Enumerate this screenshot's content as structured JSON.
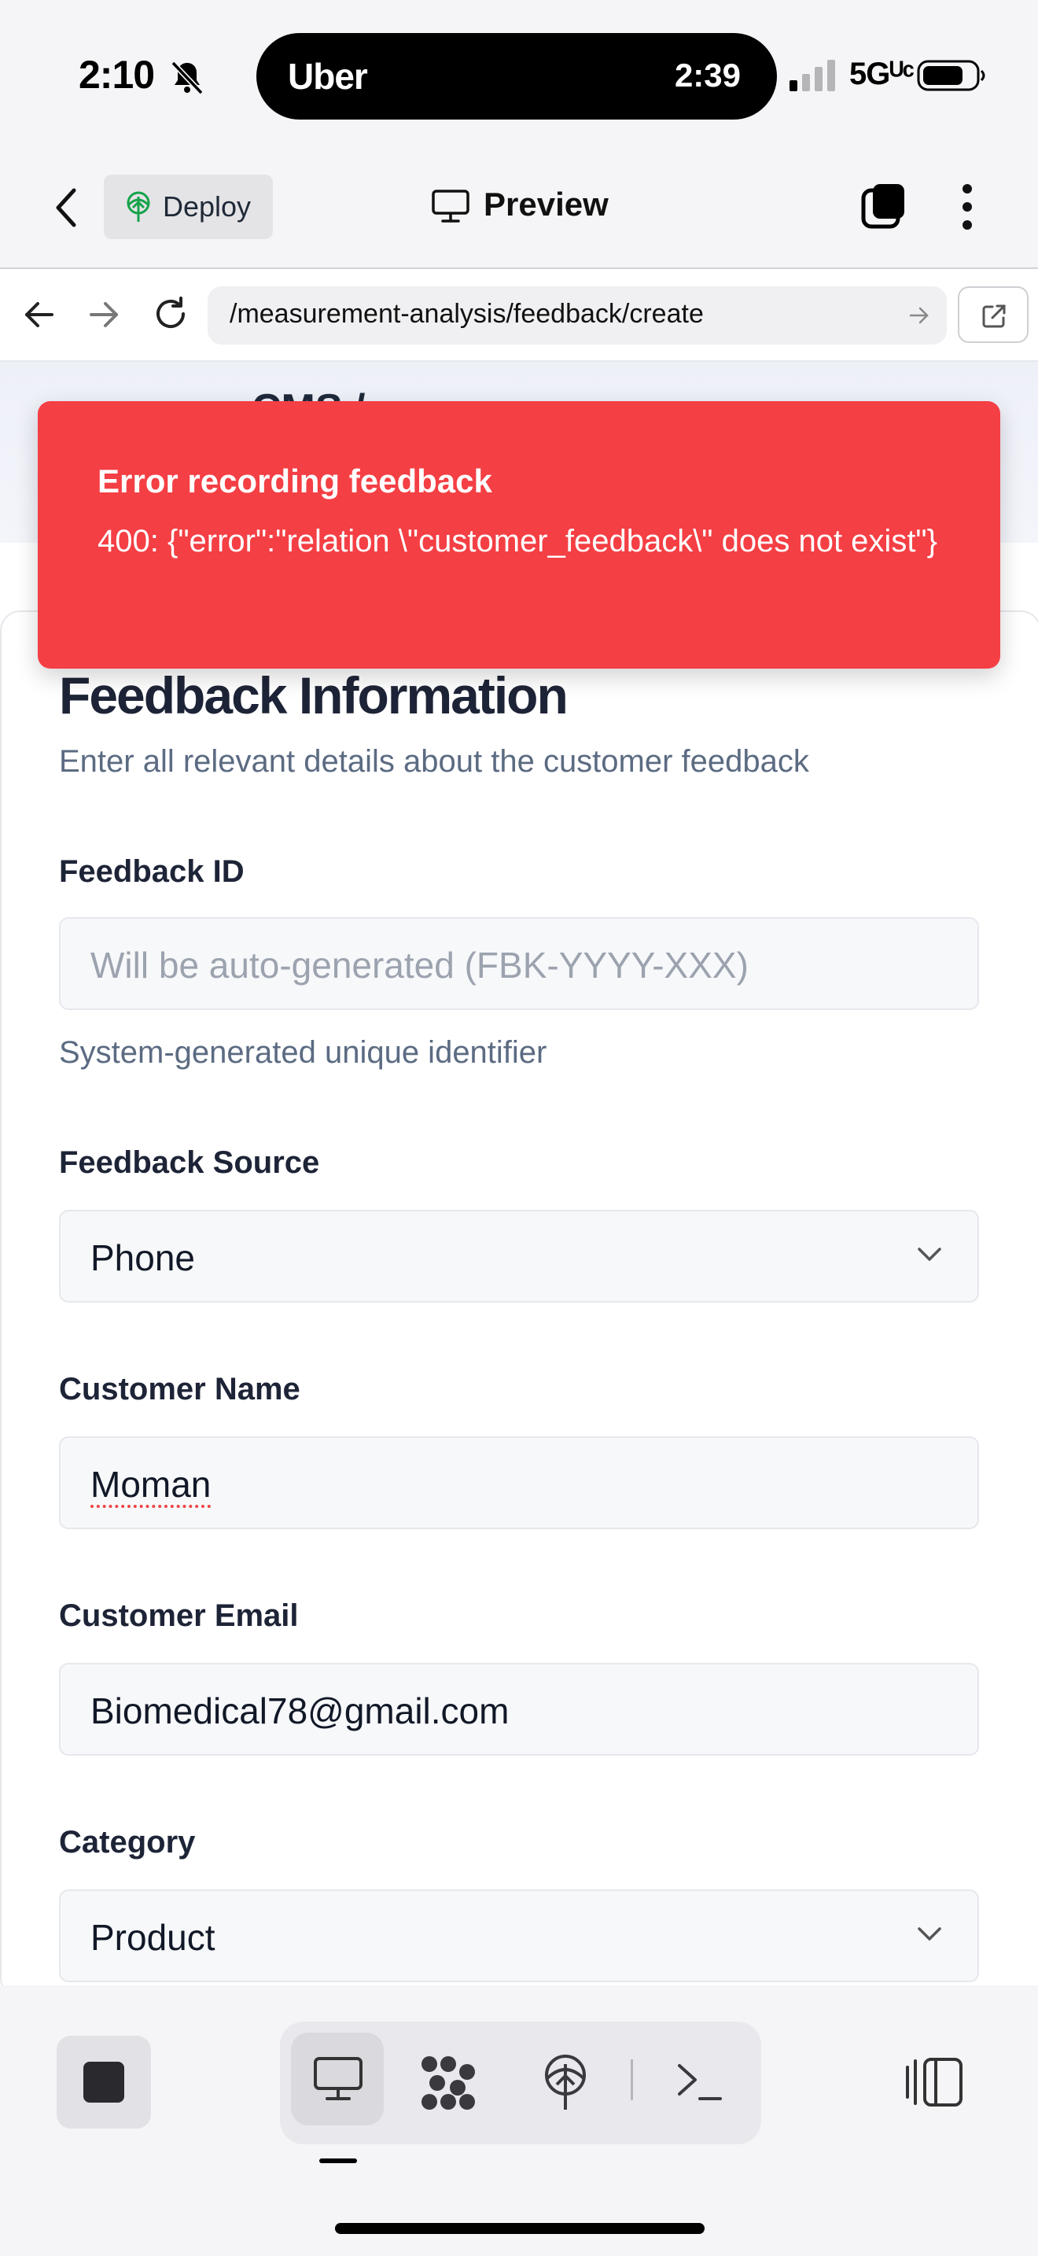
{
  "status_bar": {
    "time": "2:10",
    "island_brand": "Uber",
    "island_time": "2:39",
    "network": "5Gᵁᶜ"
  },
  "toolbar": {
    "deploy_label": "Deploy",
    "preview_label": "Preview"
  },
  "browser": {
    "url": "/measurement-analysis/feedback/create"
  },
  "page_header": {
    "fragment": "CMS /"
  },
  "toast": {
    "title": "Error recording feedback",
    "message": "400: {\"error\":\"relation \\\"customer_feedback\\\" does not exist\"}",
    "color": "#f43f44"
  },
  "form": {
    "title": "Feedback Information",
    "subtitle": "Enter all relevant details about the customer feedback",
    "feedback_id": {
      "label": "Feedback ID",
      "placeholder": "Will be auto-generated (FBK-YYYY-XXX)",
      "help": "System-generated unique identifier"
    },
    "feedback_source": {
      "label": "Feedback Source",
      "value": "Phone"
    },
    "customer_name": {
      "label": "Customer Name",
      "value": "Moman"
    },
    "customer_email": {
      "label": "Customer Email",
      "value": "Biomedical78@gmail.com"
    },
    "category": {
      "label": "Category",
      "value": "Product"
    }
  },
  "bottom_bar": {
    "icons": [
      "stop-icon",
      "desktop-icon",
      "cluster-icon",
      "deploy-tree-icon",
      "terminal-icon",
      "panel-toggle-icon"
    ]
  }
}
